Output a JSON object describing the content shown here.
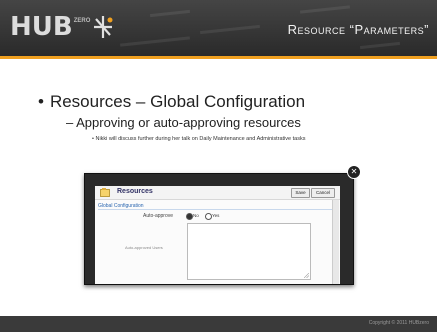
{
  "header": {
    "logo_text": "HUB",
    "logo_sup": "ZERO",
    "title": "Resource “Parameters”"
  },
  "body": {
    "bullet1": "Resources – Global Configuration",
    "bullet2": "– Approving or auto-approving resources",
    "bullet3": "Nikki will discuss further during her talk on Daily Maintenance and Administrative tasks"
  },
  "screenshot": {
    "title": "Resources",
    "save_label": "Save",
    "cancel_label": "Cancel",
    "section": "Global Configuration",
    "auto_approve_label": "Auto-approve",
    "no_label": "No",
    "yes_label": "Yes",
    "auto_approve_selected": "No",
    "list_label": "Auto-approved Users",
    "close_glyph": "✕"
  },
  "footer": {
    "copyright": "Copyright © 2011 HUBzero"
  },
  "colors": {
    "header_bg": "#333333",
    "accent": "#f0a020",
    "section_blue": "#2a66b0"
  }
}
